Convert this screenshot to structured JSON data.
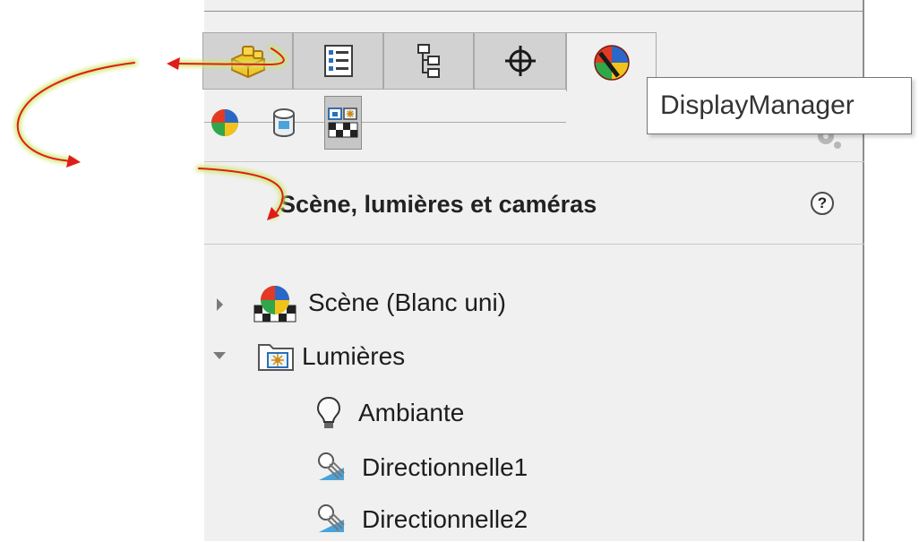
{
  "tabs": [
    {
      "id": "feature-manager",
      "icon": "yellow-blocks-icon"
    },
    {
      "id": "property-manager",
      "icon": "property-list-icon"
    },
    {
      "id": "configuration-manager",
      "icon": "configuration-tree-icon"
    },
    {
      "id": "dim-xpert-manager",
      "icon": "crosshair-icon"
    },
    {
      "id": "display-manager",
      "icon": "display-manager-sphere-icon",
      "active": true
    }
  ],
  "tooltip": {
    "text": "DisplayManager"
  },
  "subtoolbar": [
    {
      "id": "appearances",
      "icon": "appearance-sphere-icon"
    },
    {
      "id": "decals",
      "icon": "cylinder-icon"
    },
    {
      "id": "scene-lights-cameras",
      "icon": "scene-camera-icon",
      "selected": true
    }
  ],
  "panel": {
    "title": "Scène, lumières et caméras"
  },
  "tree": {
    "scene": {
      "label": "Scène (Blanc uni)",
      "expanded": false
    },
    "lights": {
      "label": "Lumières",
      "expanded": true
    },
    "children": [
      {
        "label": "Ambiante",
        "icon": "light-bulb-icon"
      },
      {
        "label": "Directionnelle1",
        "icon": "directional-light-icon"
      },
      {
        "label": "Directionnelle2",
        "icon": "directional-light-icon"
      }
    ]
  },
  "colors": {
    "panel_bg": "#f0f0f0",
    "tab_inactive": "#d2d2d2",
    "annotation_arrow": "#e01b1b",
    "annotation_glow": "#cde86a"
  }
}
